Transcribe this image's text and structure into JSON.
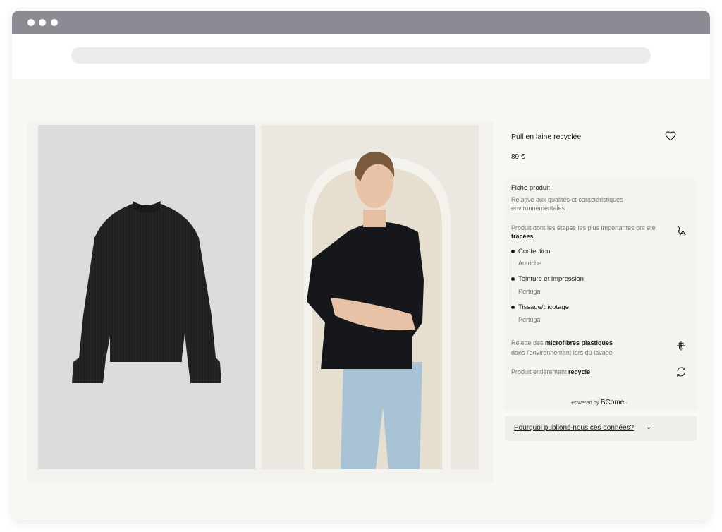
{
  "product": {
    "title": "Pull en laine recyclée",
    "price": "89 €",
    "wishlist_icon": "heart-icon",
    "images": [
      {
        "name": "sweater-flat-image",
        "alt": "black ribbed wool sweater"
      },
      {
        "name": "model-image",
        "alt": "model wearing black sweater and jeans"
      }
    ]
  },
  "fiche": {
    "title": "Fiche produit",
    "subtitle": "Relative aux qualités et caractéristiques environnementales",
    "traced_prefix": "Produit dont les étapes les plus importantes ont été ",
    "traced_bold": "tracées",
    "steps": [
      {
        "label": "Confection",
        "place": "Autriche"
      },
      {
        "label": "Teinture et impression",
        "place": "Portugal"
      },
      {
        "label": "Tissage/tricotage",
        "place": "Portugal"
      }
    ],
    "micro_prefix": "Rejette des ",
    "micro_bold": "microfibres plastiques",
    "micro_suffix": "dans l'environnement lors du lavage",
    "recycled_prefix": "Produit entièrement ",
    "recycled_bold": "recyclé",
    "powered_prefix": "Powered by ",
    "powered_brand": "BCome",
    "powered_dot": "·",
    "why_link": "Pourquoi publions-nous ces données?",
    "why_chevron": "⌄"
  },
  "colors": {
    "titlebar": "#8c8b94",
    "page_bg": "#f8f7f4",
    "text": "#1a1a1a",
    "muted": "#777777"
  }
}
